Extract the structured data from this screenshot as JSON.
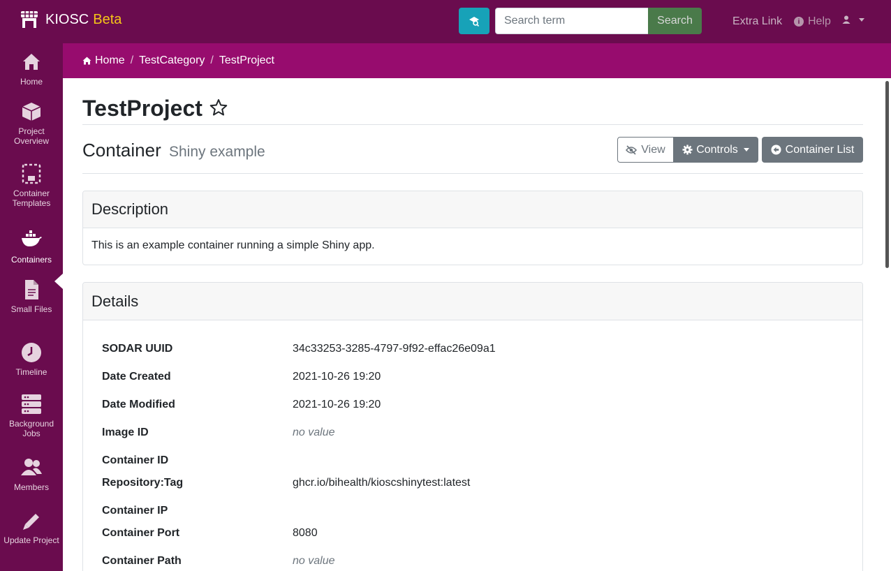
{
  "navbar": {
    "brand_name": "KIOSC",
    "brand_badge": "Beta",
    "search_placeholder": "Search term",
    "search_button": "Search",
    "extra_link": "Extra Link",
    "help": "Help"
  },
  "sidebar": {
    "items": [
      {
        "label": "Home",
        "icon": "home-icon"
      },
      {
        "label": "Project Overview",
        "icon": "cube-icon"
      },
      {
        "label": "Container Templates",
        "icon": "template-icon"
      },
      {
        "label": "Containers",
        "icon": "docker-icon"
      },
      {
        "label": "Small Files",
        "icon": "file-icon"
      },
      {
        "label": "Timeline",
        "icon": "clock-icon"
      },
      {
        "label": "Background Jobs",
        "icon": "server-icon"
      },
      {
        "label": "Members",
        "icon": "users-icon"
      },
      {
        "label": "Update Project",
        "icon": "pencil-icon"
      }
    ],
    "active_index": 3
  },
  "breadcrumb": [
    "Home",
    "TestCategory",
    "TestProject"
  ],
  "page": {
    "project_title": "TestProject",
    "section_title": "Container",
    "section_subtitle": "Shiny example"
  },
  "buttons": {
    "view": "View",
    "controls": "Controls",
    "container_list": "Container List"
  },
  "description_card": {
    "title": "Description",
    "text": "This is an example container running a simple Shiny app."
  },
  "details_card": {
    "title": "Details",
    "rows": [
      {
        "label": "SODAR UUID",
        "value": "34c33253-3285-4797-9f92-effac26e09a1"
      },
      {
        "label": "Date Created",
        "value": "2021-10-26 19:20"
      },
      {
        "label": "Date Modified",
        "value": "2021-10-26 19:20"
      },
      {
        "label": "Image ID",
        "value": "no value"
      },
      {
        "label": "Container ID",
        "value": ""
      },
      {
        "label": "Repository:Tag",
        "value": "ghcr.io/bihealth/kioscshinytest:latest"
      },
      {
        "label": "Container IP",
        "value": ""
      },
      {
        "label": "Container Port",
        "value": "8080"
      },
      {
        "label": "Container Path",
        "value": "no value"
      }
    ]
  },
  "colors": {
    "navbar": "#6a0c4e",
    "breadcrumb_bar": "#970c6e",
    "beta": "#f5c518",
    "search_button": "#4a7a4a",
    "adv_search_button": "#17a2b8",
    "secondary": "#6c757d"
  }
}
